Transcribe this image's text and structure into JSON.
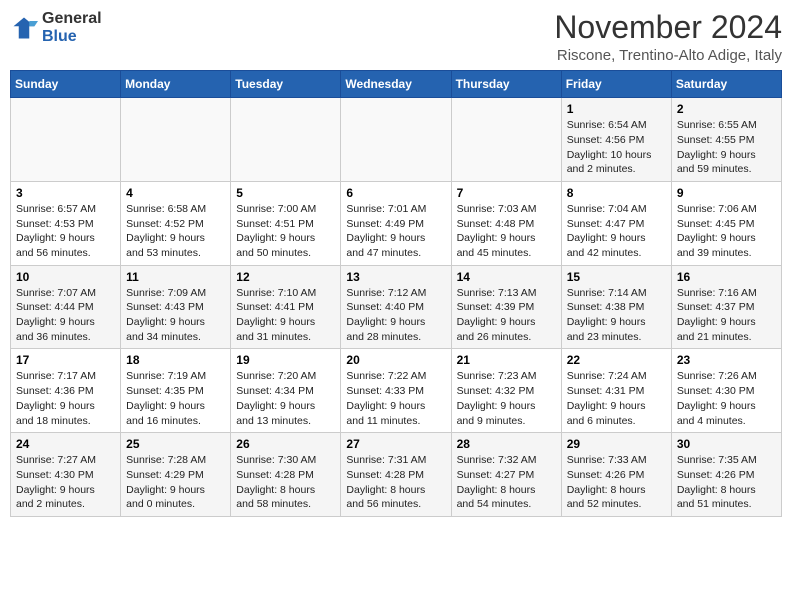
{
  "header": {
    "logo_line1": "General",
    "logo_line2": "Blue",
    "month": "November 2024",
    "location": "Riscone, Trentino-Alto Adige, Italy"
  },
  "weekdays": [
    "Sunday",
    "Monday",
    "Tuesday",
    "Wednesday",
    "Thursday",
    "Friday",
    "Saturday"
  ],
  "weeks": [
    [
      {
        "day": "",
        "info": ""
      },
      {
        "day": "",
        "info": ""
      },
      {
        "day": "",
        "info": ""
      },
      {
        "day": "",
        "info": ""
      },
      {
        "day": "",
        "info": ""
      },
      {
        "day": "1",
        "info": "Sunrise: 6:54 AM\nSunset: 4:56 PM\nDaylight: 10 hours\nand 2 minutes."
      },
      {
        "day": "2",
        "info": "Sunrise: 6:55 AM\nSunset: 4:55 PM\nDaylight: 9 hours\nand 59 minutes."
      }
    ],
    [
      {
        "day": "3",
        "info": "Sunrise: 6:57 AM\nSunset: 4:53 PM\nDaylight: 9 hours\nand 56 minutes."
      },
      {
        "day": "4",
        "info": "Sunrise: 6:58 AM\nSunset: 4:52 PM\nDaylight: 9 hours\nand 53 minutes."
      },
      {
        "day": "5",
        "info": "Sunrise: 7:00 AM\nSunset: 4:51 PM\nDaylight: 9 hours\nand 50 minutes."
      },
      {
        "day": "6",
        "info": "Sunrise: 7:01 AM\nSunset: 4:49 PM\nDaylight: 9 hours\nand 47 minutes."
      },
      {
        "day": "7",
        "info": "Sunrise: 7:03 AM\nSunset: 4:48 PM\nDaylight: 9 hours\nand 45 minutes."
      },
      {
        "day": "8",
        "info": "Sunrise: 7:04 AM\nSunset: 4:47 PM\nDaylight: 9 hours\nand 42 minutes."
      },
      {
        "day": "9",
        "info": "Sunrise: 7:06 AM\nSunset: 4:45 PM\nDaylight: 9 hours\nand 39 minutes."
      }
    ],
    [
      {
        "day": "10",
        "info": "Sunrise: 7:07 AM\nSunset: 4:44 PM\nDaylight: 9 hours\nand 36 minutes."
      },
      {
        "day": "11",
        "info": "Sunrise: 7:09 AM\nSunset: 4:43 PM\nDaylight: 9 hours\nand 34 minutes."
      },
      {
        "day": "12",
        "info": "Sunrise: 7:10 AM\nSunset: 4:41 PM\nDaylight: 9 hours\nand 31 minutes."
      },
      {
        "day": "13",
        "info": "Sunrise: 7:12 AM\nSunset: 4:40 PM\nDaylight: 9 hours\nand 28 minutes."
      },
      {
        "day": "14",
        "info": "Sunrise: 7:13 AM\nSunset: 4:39 PM\nDaylight: 9 hours\nand 26 minutes."
      },
      {
        "day": "15",
        "info": "Sunrise: 7:14 AM\nSunset: 4:38 PM\nDaylight: 9 hours\nand 23 minutes."
      },
      {
        "day": "16",
        "info": "Sunrise: 7:16 AM\nSunset: 4:37 PM\nDaylight: 9 hours\nand 21 minutes."
      }
    ],
    [
      {
        "day": "17",
        "info": "Sunrise: 7:17 AM\nSunset: 4:36 PM\nDaylight: 9 hours\nand 18 minutes."
      },
      {
        "day": "18",
        "info": "Sunrise: 7:19 AM\nSunset: 4:35 PM\nDaylight: 9 hours\nand 16 minutes."
      },
      {
        "day": "19",
        "info": "Sunrise: 7:20 AM\nSunset: 4:34 PM\nDaylight: 9 hours\nand 13 minutes."
      },
      {
        "day": "20",
        "info": "Sunrise: 7:22 AM\nSunset: 4:33 PM\nDaylight: 9 hours\nand 11 minutes."
      },
      {
        "day": "21",
        "info": "Sunrise: 7:23 AM\nSunset: 4:32 PM\nDaylight: 9 hours\nand 9 minutes."
      },
      {
        "day": "22",
        "info": "Sunrise: 7:24 AM\nSunset: 4:31 PM\nDaylight: 9 hours\nand 6 minutes."
      },
      {
        "day": "23",
        "info": "Sunrise: 7:26 AM\nSunset: 4:30 PM\nDaylight: 9 hours\nand 4 minutes."
      }
    ],
    [
      {
        "day": "24",
        "info": "Sunrise: 7:27 AM\nSunset: 4:30 PM\nDaylight: 9 hours\nand 2 minutes."
      },
      {
        "day": "25",
        "info": "Sunrise: 7:28 AM\nSunset: 4:29 PM\nDaylight: 9 hours\nand 0 minutes."
      },
      {
        "day": "26",
        "info": "Sunrise: 7:30 AM\nSunset: 4:28 PM\nDaylight: 8 hours\nand 58 minutes."
      },
      {
        "day": "27",
        "info": "Sunrise: 7:31 AM\nSunset: 4:28 PM\nDaylight: 8 hours\nand 56 minutes."
      },
      {
        "day": "28",
        "info": "Sunrise: 7:32 AM\nSunset: 4:27 PM\nDaylight: 8 hours\nand 54 minutes."
      },
      {
        "day": "29",
        "info": "Sunrise: 7:33 AM\nSunset: 4:26 PM\nDaylight: 8 hours\nand 52 minutes."
      },
      {
        "day": "30",
        "info": "Sunrise: 7:35 AM\nSunset: 4:26 PM\nDaylight: 8 hours\nand 51 minutes."
      }
    ]
  ]
}
